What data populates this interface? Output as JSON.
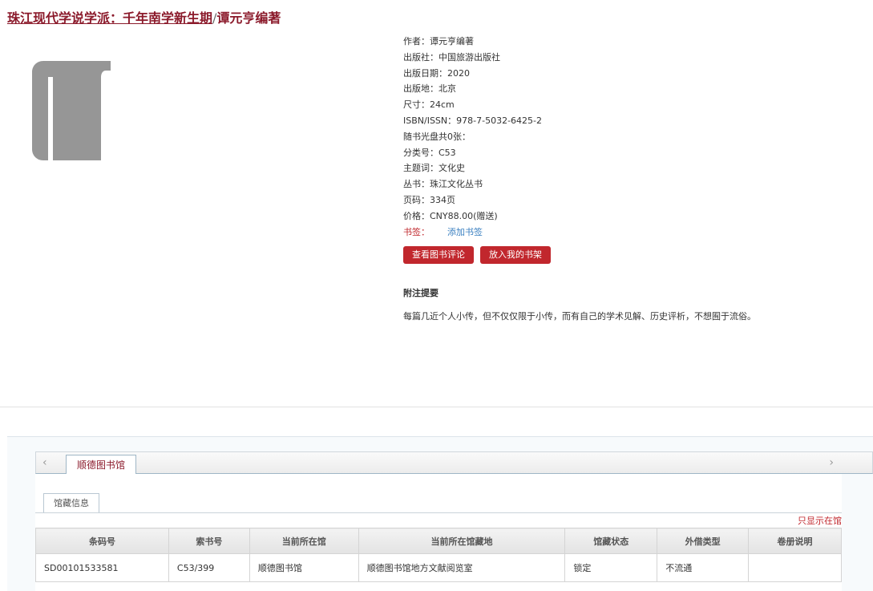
{
  "header": {
    "book_title": "珠江现代学说学派：千年南学新生期",
    "separator": "/",
    "author": "谭元亨编著"
  },
  "cover": {
    "icon": "book-icon",
    "color": "#969696"
  },
  "meta": {
    "rows": [
      "作者：谭元亨编著",
      "出版社：中国旅游出版社",
      "出版日期：2020",
      "出版地：北京",
      "尺寸：24cm",
      "ISBN/ISSN：978-7-5032-6425-2",
      "随书光盘共0张：",
      "分类号：C53",
      "主题词：文化史",
      "丛书：珠江文化丛书",
      "页码：334页",
      "价格：CNY88.00(赠送)"
    ],
    "bookmark_label": "书签：",
    "bookmark_link": "添加书签"
  },
  "buttons": {
    "review": "查看图书评论",
    "shelf": "放入我的书架"
  },
  "notes": {
    "heading": "附注提要",
    "text": "每篇几近个人小传，但不仅仅限于小传，而有自己的学术见解、历史评析，不想囿于流俗。"
  },
  "library_tabs": {
    "prev": "‹",
    "next": "›",
    "active": "顺德图书馆"
  },
  "holdings": {
    "sub_tab": "馆藏信息",
    "only_available": "只显示在馆",
    "columns": [
      "条码号",
      "索书号",
      "当前所在馆",
      "当前所在馆藏地",
      "馆藏状态",
      "外借类型",
      "卷册说明"
    ],
    "rows": [
      [
        "SD00101533581",
        "C53/399",
        "顺德图书馆",
        "顺德图书馆地方文献阅览室",
        "锁定",
        "不流通",
        ""
      ]
    ]
  },
  "colors": {
    "brand_red": "#c1272d",
    "title_red": "#8b1a2b",
    "link_blue": "#3a7fc0"
  }
}
